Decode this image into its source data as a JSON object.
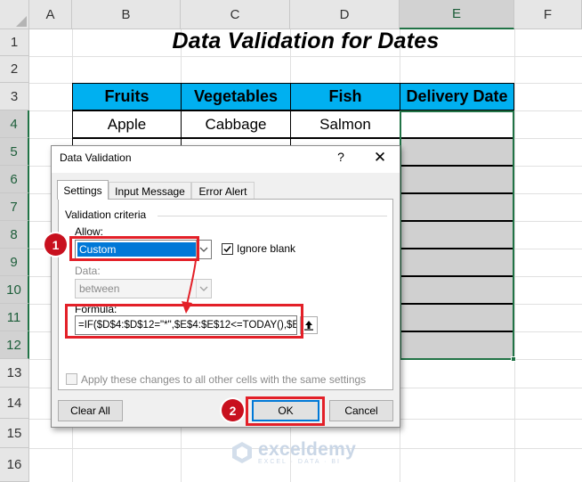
{
  "sheet": {
    "columns": [
      "A",
      "B",
      "C",
      "D",
      "E",
      "F"
    ],
    "selected_column": "E",
    "rows": [
      "1",
      "2",
      "3",
      "4",
      "5",
      "6",
      "7",
      "8",
      "9",
      "10",
      "11",
      "12",
      "13",
      "14",
      "15",
      "16"
    ],
    "selected_rows": [
      "4",
      "5",
      "6",
      "7",
      "8",
      "9",
      "10",
      "11",
      "12"
    ],
    "title": "Data Validation for Dates",
    "table": {
      "headers": [
        "Fruits",
        "Vegetables",
        "Fish",
        "Delivery Date"
      ],
      "row4": [
        "Apple",
        "Cabbage",
        "Salmon",
        ""
      ]
    },
    "colors": {
      "header_fill": "#00b0f0",
      "validated_cells_fill": "#d0d0d0",
      "selection_border": "#217346"
    }
  },
  "dialog": {
    "title": "Data Validation",
    "help_glyph": "?",
    "close_glyph": "✕",
    "tabs": [
      "Settings",
      "Input Message",
      "Error Alert"
    ],
    "active_tab": "Settings",
    "validation_criteria_label": "Validation criteria",
    "allow_label": "Allow:",
    "allow_value": "Custom",
    "ignore_blank_label": "Ignore blank",
    "ignore_blank_checked": true,
    "data_label": "Data:",
    "data_value": "between",
    "formula_label": "Formula:",
    "formula_value": "=IF($D$4:$D$12=\"*\",$E$4:$E$12<=TODAY(),$E$4",
    "apply_all_label": "Apply these changes to all other cells with the same settings",
    "clear_all_label": "Clear All",
    "ok_label": "OK",
    "cancel_label": "Cancel"
  },
  "annotations": {
    "badge1": "1",
    "badge2": "2",
    "highlight_color": "#e32028"
  },
  "watermark": {
    "name": "exceldemy",
    "tagline": "EXCEL · DATA · BI"
  }
}
